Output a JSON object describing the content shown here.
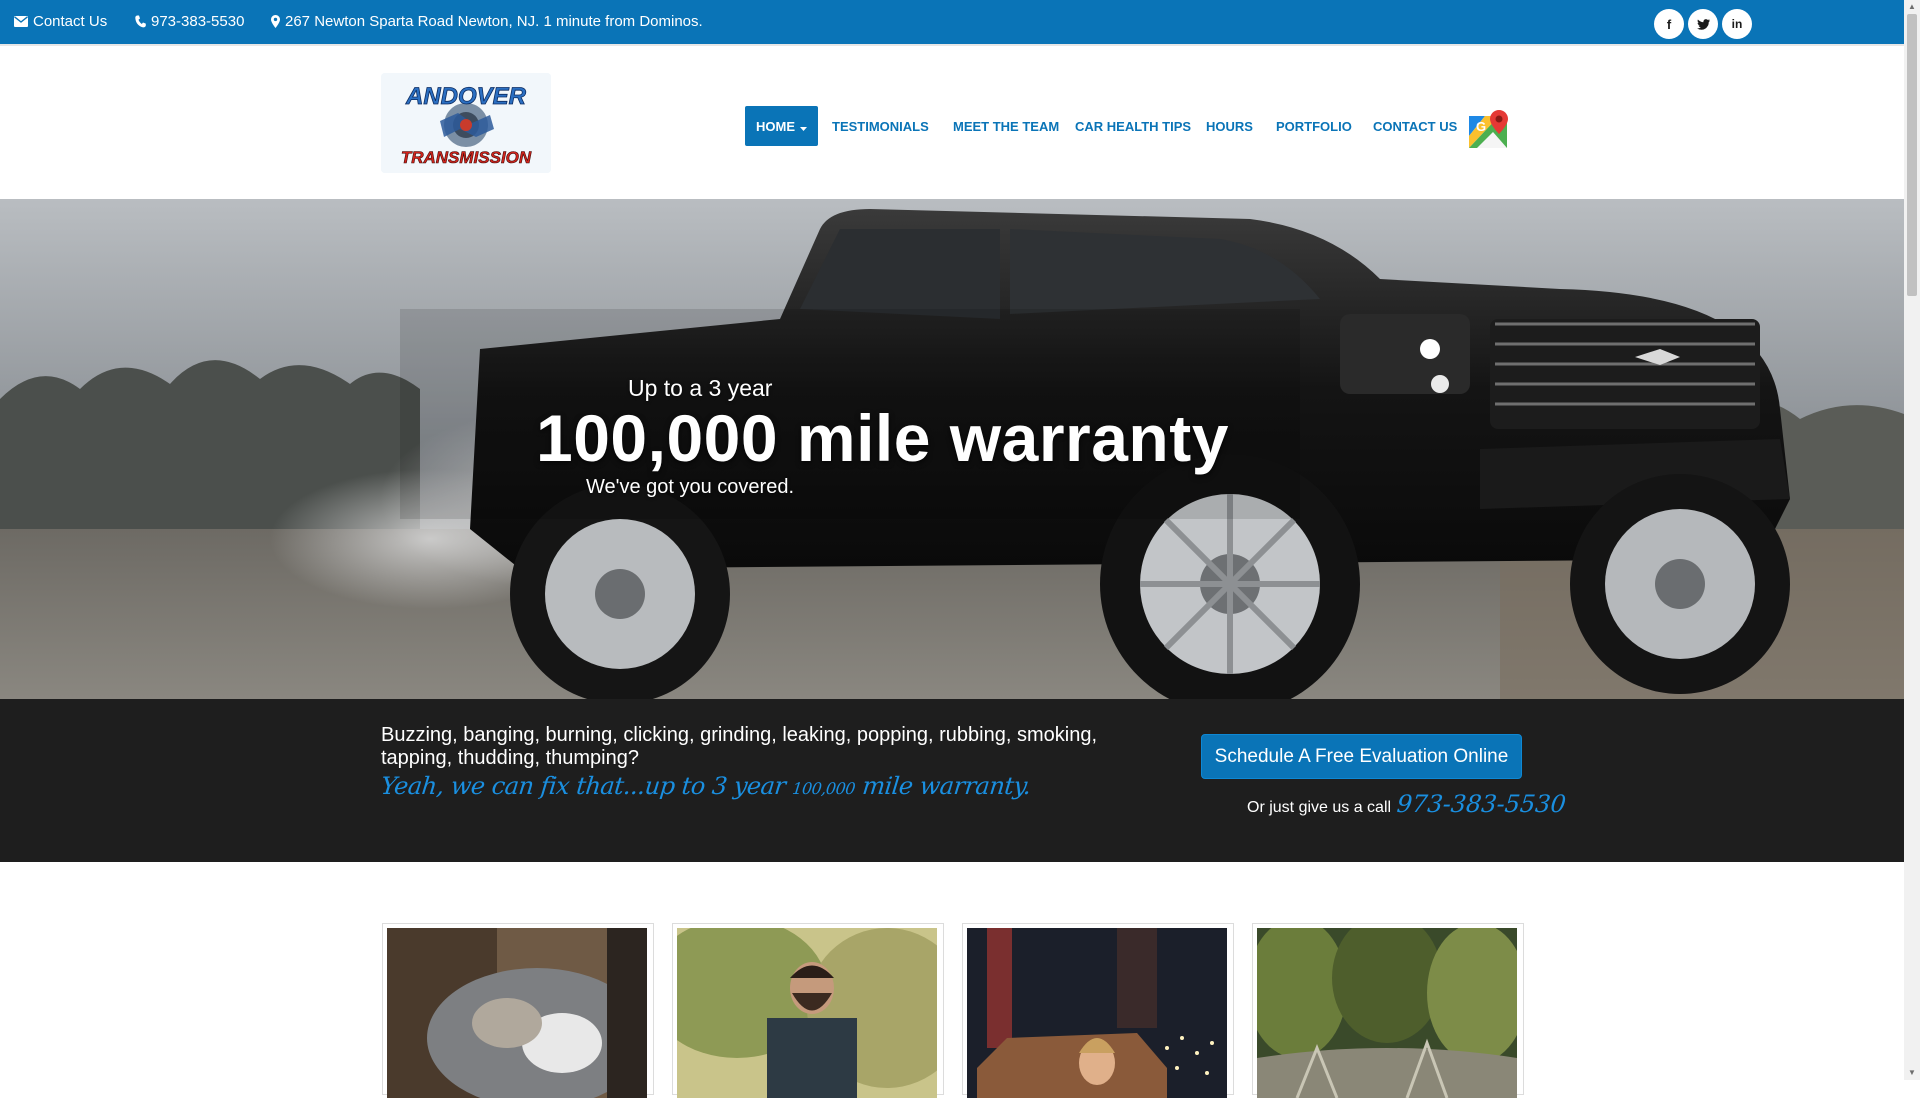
{
  "topbar": {
    "contact_label": "Contact Us",
    "phone": "973-383-5530",
    "address": "267 Newton Sparta Road Newton, NJ. 1 minute from Dominos.",
    "social": [
      {
        "icon": "facebook-icon",
        "glyph": "f"
      },
      {
        "icon": "twitter-icon",
        "glyph": "t"
      },
      {
        "icon": "linkedin-icon",
        "glyph": "in"
      }
    ]
  },
  "header": {
    "logo": {
      "line1": "ANDOVER",
      "line2": "TRANSMISSION"
    },
    "nav": {
      "home": "HOME",
      "testimonials": "TESTIMONIALS",
      "meet_team": "MEET THE TEAM",
      "car_health": "CAR HEALTH TIPS",
      "hours": "HOURS",
      "portfolio": "PORTFOLIO",
      "contact": "CONTACT US"
    },
    "maps_icon": "google-maps-icon"
  },
  "hero": {
    "eyebrow": "Up to a 3 year",
    "title": "100,000 mile warranty",
    "subtitle": "We've got you covered."
  },
  "band": {
    "text": "Buzzing, banging, burning, clicking, grinding, leaking, popping, rubbing, smoking, tapping, thudding, thumping?",
    "tag_a": "Yeah, we can fix that...up to 3 year ",
    "tag_num": "100,000",
    "tag_b": " mile warranty.",
    "cta": "Schedule A Free Evaluation Online",
    "call_prefix": "Or just give us a call",
    "call_number": "973-383-5530"
  },
  "colors": {
    "brand_blue": "#0a74b7",
    "accent_blue": "#1a8fe0",
    "band_dark": "#1e1e1e"
  }
}
